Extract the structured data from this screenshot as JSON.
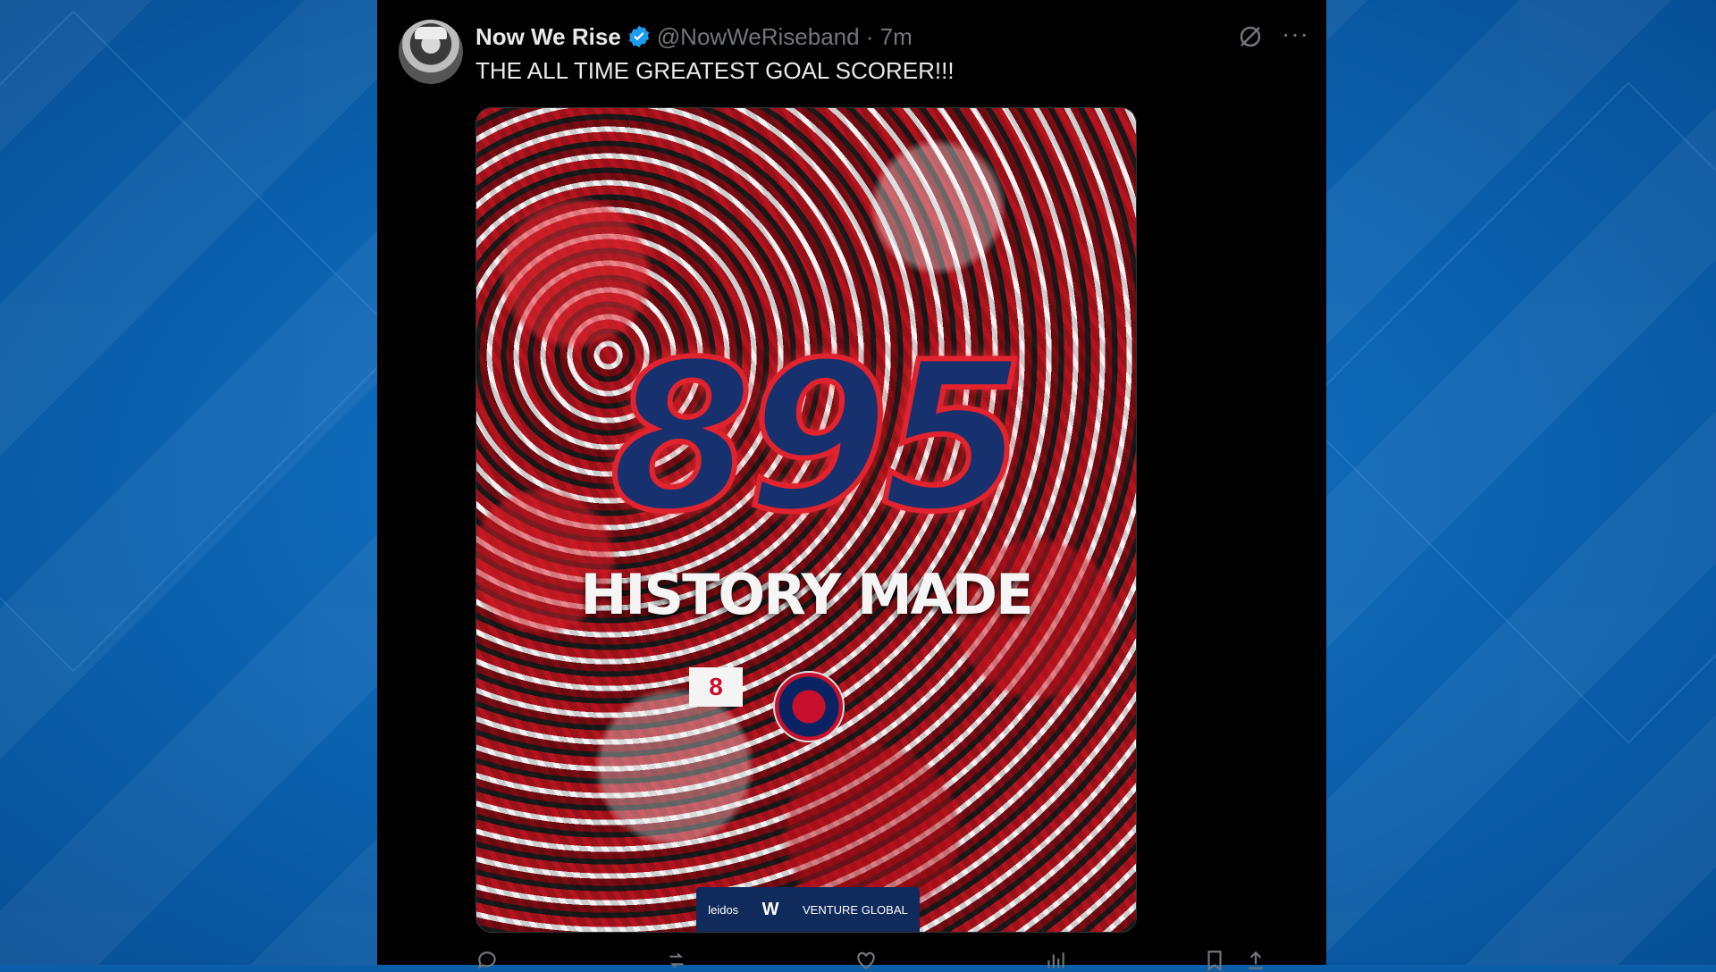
{
  "tweet": {
    "author_name": "Now We Rise",
    "handle_meta": "@NowWeRiseband · 7m",
    "text": "THE ALL TIME GREATEST GOAL SCORER!!!",
    "media": {
      "big_number": "895",
      "headline": "HISTORY MADE",
      "sign_text": "8",
      "sponsors": [
        "leidos",
        "VENTURE GLOBAL"
      ]
    }
  },
  "icons": {
    "verified": "verified-badge-icon",
    "grok": "grok-icon",
    "more": "more-icon",
    "actions": [
      "reply-icon",
      "retweet-icon",
      "like-icon",
      "views-icon",
      "bookmark-icon",
      "share-icon"
    ]
  },
  "colors": {
    "verified": "#1d9bf0",
    "text": "#e7e9ea",
    "muted": "#71767b",
    "background": "#000000"
  }
}
